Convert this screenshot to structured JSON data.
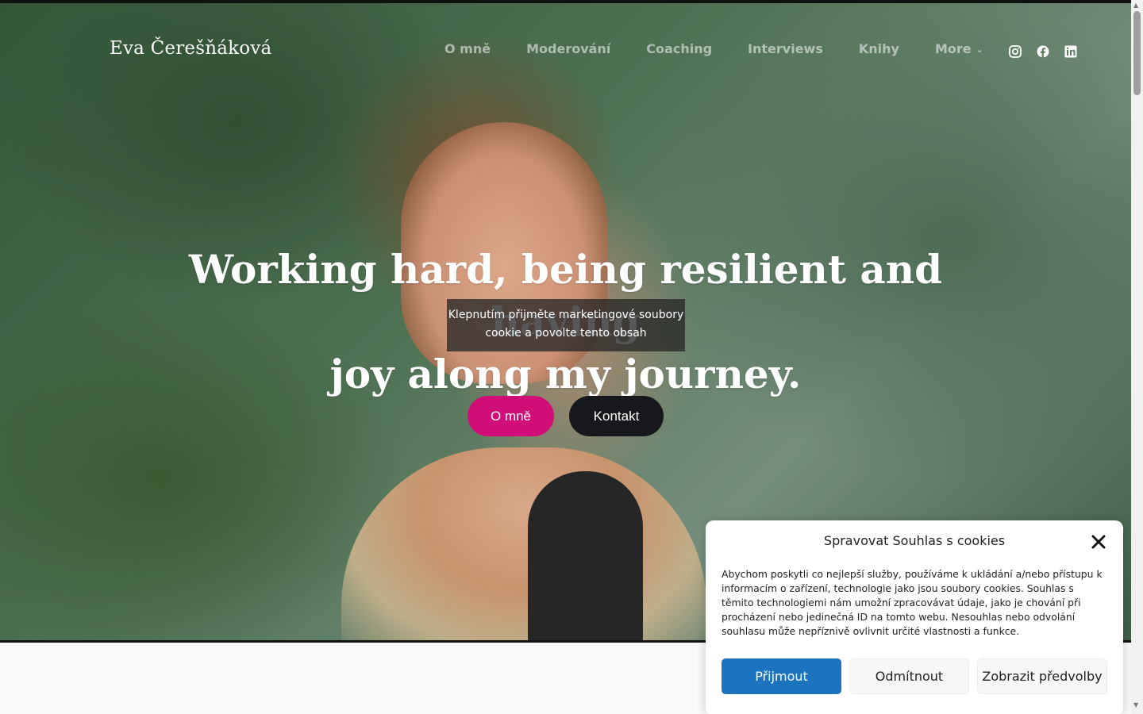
{
  "header": {
    "brand": "Eva Čerešňáková",
    "nav": [
      {
        "label": "O mně"
      },
      {
        "label": "Moderování"
      },
      {
        "label": "Coaching"
      },
      {
        "label": "Interviews"
      },
      {
        "label": "Knihy"
      },
      {
        "label": "More"
      }
    ],
    "socials": [
      "instagram-icon",
      "facebook-icon",
      "linkedin-icon"
    ]
  },
  "hero": {
    "headline_line1": "Working hard, being resilient and having",
    "headline_line2": "joy along my journey.",
    "cookie_notice": "Klepnutím přijměte marketingové soubory cookie a povolte tento obsah",
    "btn_about": "O mně",
    "btn_contact": "Kontakt"
  },
  "cookie_modal": {
    "title": "Spravovat Souhlas s cookies",
    "text": "Abychom poskytli co nejlepší služby, používáme k ukládání a/nebo přístupu k informacím o zařízení, technologie jako jsou soubory cookies. Souhlas s těmito technologiemi nám umožní zpracovávat údaje, jako je chování při procházení nebo jedinečná ID na tomto webu. Nesouhlas nebo odvolání souhlasu může nepříznivě ovlivnit určité vlastnosti a funkce.",
    "accept": "Přijmout",
    "deny": "Odmítnout",
    "prefs": "Zobrazit předvolby"
  },
  "colors": {
    "accent_pink": "#d10d77",
    "dark_button": "#16181b",
    "accept_blue": "#1e73be"
  }
}
